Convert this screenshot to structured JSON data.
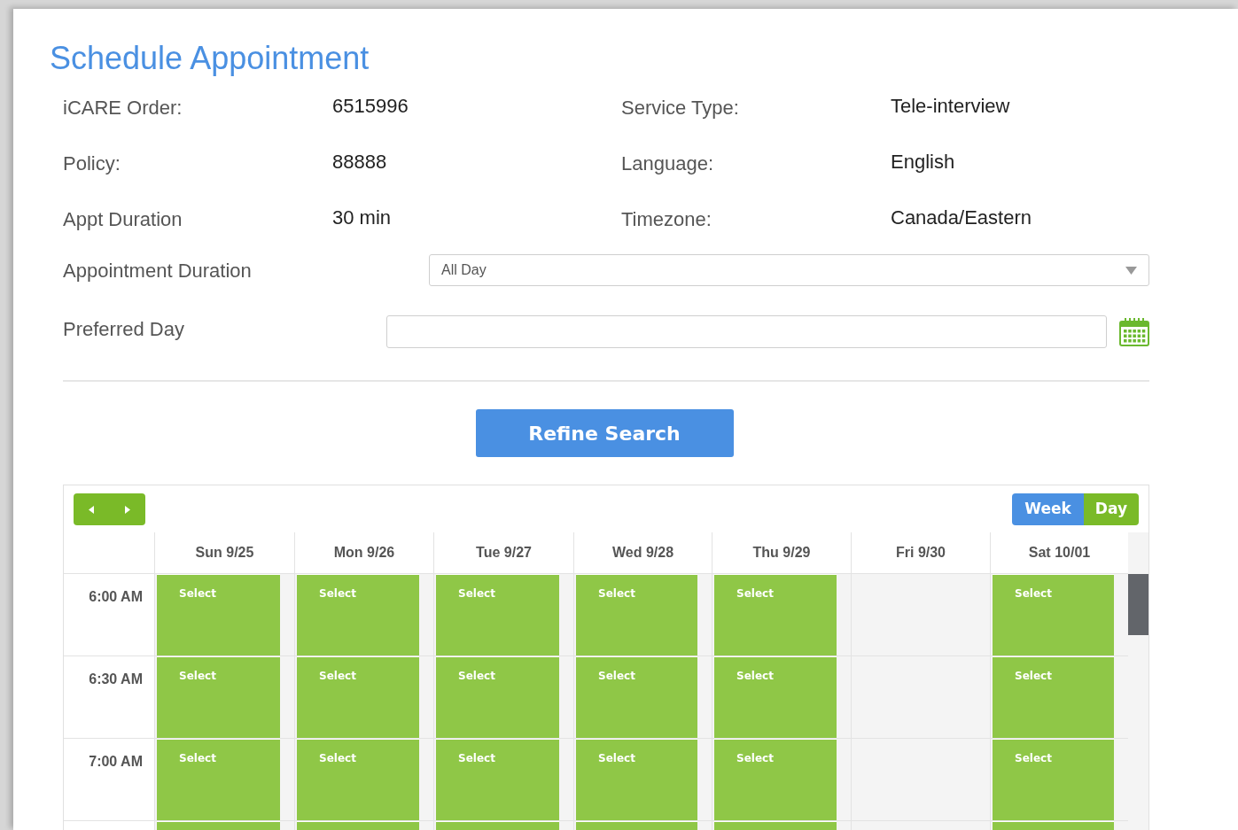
{
  "title": "Schedule Appointment",
  "info": [
    {
      "label": "iCARE Order:",
      "value": "6515996"
    },
    {
      "label": "Service Type:",
      "value": "Tele-interview"
    },
    {
      "label": "Policy:",
      "value": "88888"
    },
    {
      "label": "Language:",
      "value": "English"
    },
    {
      "label": "Appt Duration",
      "value": "30 min"
    },
    {
      "label": "Timezone:",
      "value": "Canada/Eastern"
    }
  ],
  "appointment_duration": {
    "label": "Appointment Duration",
    "value": "All Day"
  },
  "preferred_day": {
    "label": "Preferred Day"
  },
  "refine_button": "Refine Search",
  "calendar": {
    "views": [
      {
        "label": "Week",
        "selected": true
      },
      {
        "label": "Day",
        "selected": false
      }
    ],
    "days": [
      "Sun 9/25",
      "Mon 9/26",
      "Tue 9/27",
      "Wed 9/28",
      "Thu 9/29",
      "Fri 9/30",
      "Sat 10/01"
    ],
    "rows": [
      {
        "time": "6:00 AM",
        "slots": [
          {
            "available": true,
            "label": "Select"
          },
          {
            "available": true,
            "label": "Select"
          },
          {
            "available": true,
            "label": "Select"
          },
          {
            "available": true,
            "label": "Select"
          },
          {
            "available": true,
            "label": "Select"
          },
          {
            "available": false
          },
          {
            "available": true,
            "label": "Select"
          }
        ]
      },
      {
        "time": "6:30 AM",
        "slots": [
          {
            "available": true,
            "label": "Select"
          },
          {
            "available": true,
            "label": "Select"
          },
          {
            "available": true,
            "label": "Select"
          },
          {
            "available": true,
            "label": "Select"
          },
          {
            "available": true,
            "label": "Select"
          },
          {
            "available": false
          },
          {
            "available": true,
            "label": "Select"
          }
        ]
      },
      {
        "time": "7:00 AM",
        "slots": [
          {
            "available": true,
            "label": "Select"
          },
          {
            "available": true,
            "label": "Select"
          },
          {
            "available": true,
            "label": "Select"
          },
          {
            "available": true,
            "label": "Select"
          },
          {
            "available": true,
            "label": "Select"
          },
          {
            "available": false
          },
          {
            "available": true,
            "label": "Select"
          }
        ]
      },
      {
        "slots": [
          {
            "available": true
          },
          {
            "available": true
          },
          {
            "available": true
          },
          {
            "available": true
          },
          {
            "available": true
          },
          {
            "available": false
          },
          {
            "available": true
          }
        ]
      }
    ]
  }
}
